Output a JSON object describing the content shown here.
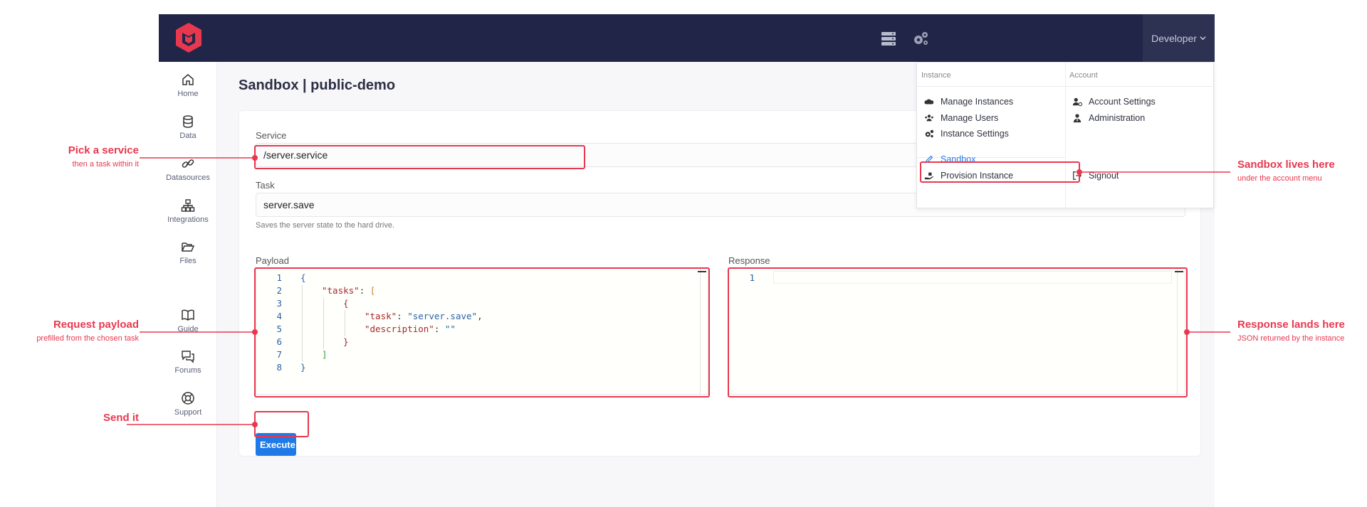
{
  "header": {
    "user_label": "Developer"
  },
  "sidebar": {
    "items": [
      {
        "label": "Home"
      },
      {
        "label": "Data"
      },
      {
        "label": "Datasources"
      },
      {
        "label": "Integrations"
      },
      {
        "label": "Files"
      },
      {
        "label": "Guide"
      },
      {
        "label": "Forums"
      },
      {
        "label": "Support"
      }
    ]
  },
  "page": {
    "title": "Sandbox | public-demo"
  },
  "form": {
    "service_label": "Service",
    "service_value": "/server.service",
    "task_label": "Task",
    "task_value": "server.save",
    "task_hint": "Saves the server state to the hard drive.",
    "payload_label": "Payload",
    "response_label": "Response",
    "execute_label": "Execute"
  },
  "payload_lines": {
    "numbers": [
      "1",
      "2",
      "3",
      "4",
      "5",
      "6",
      "7",
      "8"
    ],
    "tasks_key": "\"tasks\"",
    "task_key": "\"task\"",
    "task_val": "\"server.save\"",
    "desc_key": "\"description\"",
    "desc_val": "\"\""
  },
  "response_lines": {
    "numbers": [
      "1"
    ]
  },
  "dropdown": {
    "instance_header": "Instance",
    "account_header": "Account",
    "instance_items": [
      "Manage Instances",
      "Manage Users",
      "Instance Settings",
      "Sandbox",
      "Provision Instance"
    ],
    "account_items": [
      "Account Settings",
      "Administration",
      "Signout"
    ]
  },
  "callouts": {
    "service": {
      "title": "Pick a service",
      "sub": "then a task within it"
    },
    "payload": {
      "title": "Request payload",
      "sub": "prefilled from the chosen task"
    },
    "send": {
      "title": "Send it"
    },
    "sandbox": {
      "title": "Sandbox lives here",
      "sub": "under the account menu"
    },
    "response": {
      "title": "Response lands here",
      "sub": "JSON returned by the instance"
    }
  },
  "colors": {
    "navbar": "#212547",
    "accent": "#1f7ae8",
    "annotation": "#e8384f"
  }
}
